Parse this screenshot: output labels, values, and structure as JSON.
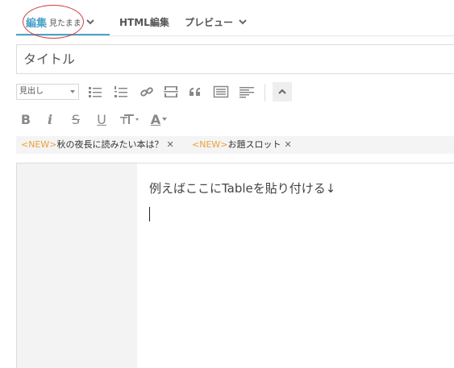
{
  "tabs": {
    "edit_label": "編集",
    "edit_mode": "見たまま",
    "html_label": "HTML編集",
    "preview_label": "プレビュー"
  },
  "title": {
    "placeholder": "タイトル"
  },
  "toolbar": {
    "block_format": "見出し",
    "icons": [
      "bulleted-list-icon",
      "numbered-list-icon",
      "link-icon",
      "more-separator-icon",
      "blockquote-icon",
      "table-of-contents-icon",
      "align-icon",
      "collapse-toolbar-icon"
    ],
    "format_buttons": {
      "bold": "B",
      "italic": "i",
      "strike": "S",
      "underline": "U",
      "font_size": "T",
      "text_color": "A"
    }
  },
  "tags": [
    {
      "new": "<NEW>",
      "text": "秋の夜長に読みたい本は？"
    },
    {
      "new": "<NEW>",
      "text": "お題スロット"
    }
  ],
  "editor": {
    "content": "例えばここにTableを貼り付ける↓"
  },
  "colors": {
    "accent": "#4aa3c9",
    "new_tag": "#e8a33a",
    "annotation": "#d13c3c"
  }
}
